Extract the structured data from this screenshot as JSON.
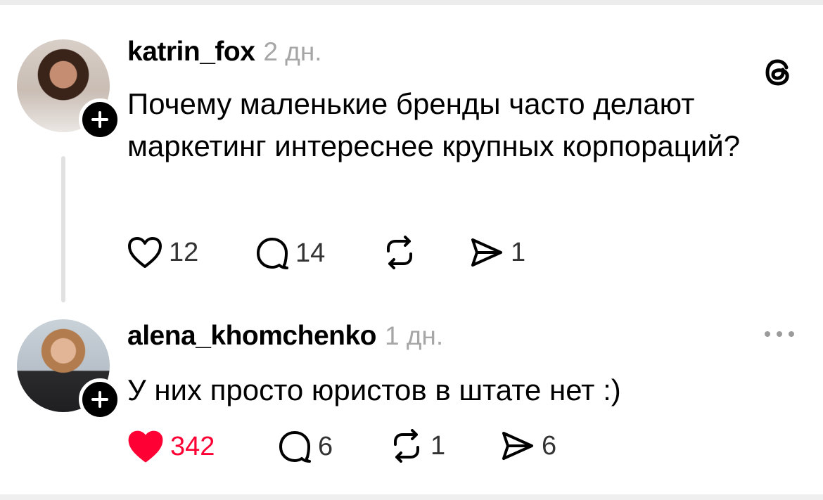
{
  "posts": [
    {
      "username": "katrin_fox",
      "time": "2 дн.",
      "text": "Почему маленькие бренды часто делают маркетинг интереснее крупных корпораций?",
      "likes": "12",
      "liked": false,
      "replies": "14",
      "reposts": "",
      "shares": "1"
    },
    {
      "username": "alena_khomchenko",
      "time": "1 дн.",
      "text": "У них просто юристов в штате нет :)",
      "likes": "342",
      "liked": true,
      "replies": "6",
      "reposts": "1",
      "shares": "6"
    }
  ],
  "colors": {
    "like_active": "#ff0034",
    "muted_text": "#a6a6a6",
    "thread_line": "#e1e1e1"
  },
  "icons": [
    "threads-logo-icon",
    "more-icon",
    "heart-icon",
    "comment-icon",
    "repost-icon",
    "share-icon",
    "plus-icon"
  ]
}
